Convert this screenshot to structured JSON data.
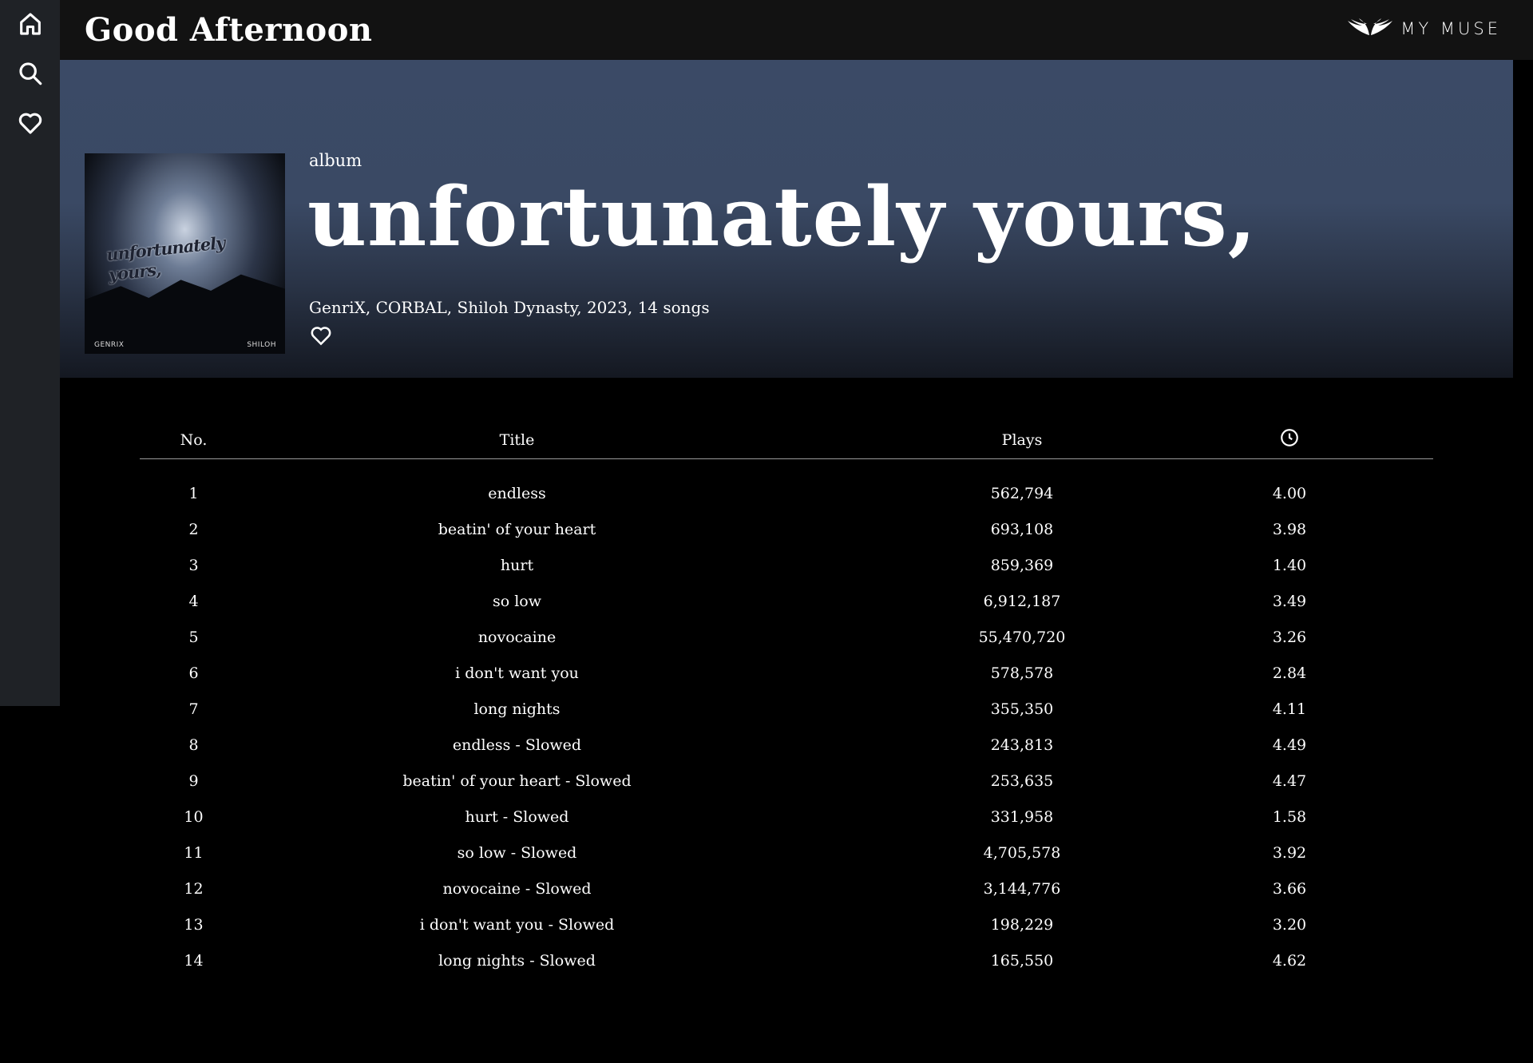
{
  "header": {
    "greeting": "Good Afternoon",
    "brand": "MY MUSE"
  },
  "sidebar": {
    "items": [
      {
        "icon": "home-icon"
      },
      {
        "icon": "search-icon"
      },
      {
        "icon": "heart-icon"
      }
    ]
  },
  "album": {
    "type_label": "album",
    "title": "unfortunately yours,",
    "meta": "GenriX, CORBAL, Shiloh Dynasty, 2023, 14 songs",
    "cover": {
      "title_text": "unfortunately yours,",
      "left_credit": "GENRIX",
      "right_credit": "SHILOH"
    }
  },
  "table": {
    "headers": {
      "no": "No.",
      "title": "Title",
      "plays": "Plays",
      "duration_icon": "clock-icon"
    },
    "rows": [
      {
        "no": "1",
        "title": "endless",
        "plays": "562,794",
        "duration": "4.00"
      },
      {
        "no": "2",
        "title": "beatin' of your heart",
        "plays": "693,108",
        "duration": "3.98"
      },
      {
        "no": "3",
        "title": "hurt",
        "plays": "859,369",
        "duration": "1.40"
      },
      {
        "no": "4",
        "title": "so low",
        "plays": "6,912,187",
        "duration": "3.49"
      },
      {
        "no": "5",
        "title": "novocaine",
        "plays": "55,470,720",
        "duration": "3.26"
      },
      {
        "no": "6",
        "title": "i don't want you",
        "plays": "578,578",
        "duration": "2.84"
      },
      {
        "no": "7",
        "title": "long nights",
        "plays": "355,350",
        "duration": "4.11"
      },
      {
        "no": "8",
        "title": "endless - Slowed",
        "plays": "243,813",
        "duration": "4.49"
      },
      {
        "no": "9",
        "title": "beatin' of your heart - Slowed",
        "plays": "253,635",
        "duration": "4.47"
      },
      {
        "no": "10",
        "title": "hurt - Slowed",
        "plays": "331,958",
        "duration": "1.58"
      },
      {
        "no": "11",
        "title": "so low - Slowed",
        "plays": "4,705,578",
        "duration": "3.92"
      },
      {
        "no": "12",
        "title": "novocaine - Slowed",
        "plays": "3,144,776",
        "duration": "3.66"
      },
      {
        "no": "13",
        "title": "i don't want you - Slowed",
        "plays": "198,229",
        "duration": "3.20"
      },
      {
        "no": "14",
        "title": "long nights - Slowed",
        "plays": "165,550",
        "duration": "4.62"
      }
    ]
  }
}
